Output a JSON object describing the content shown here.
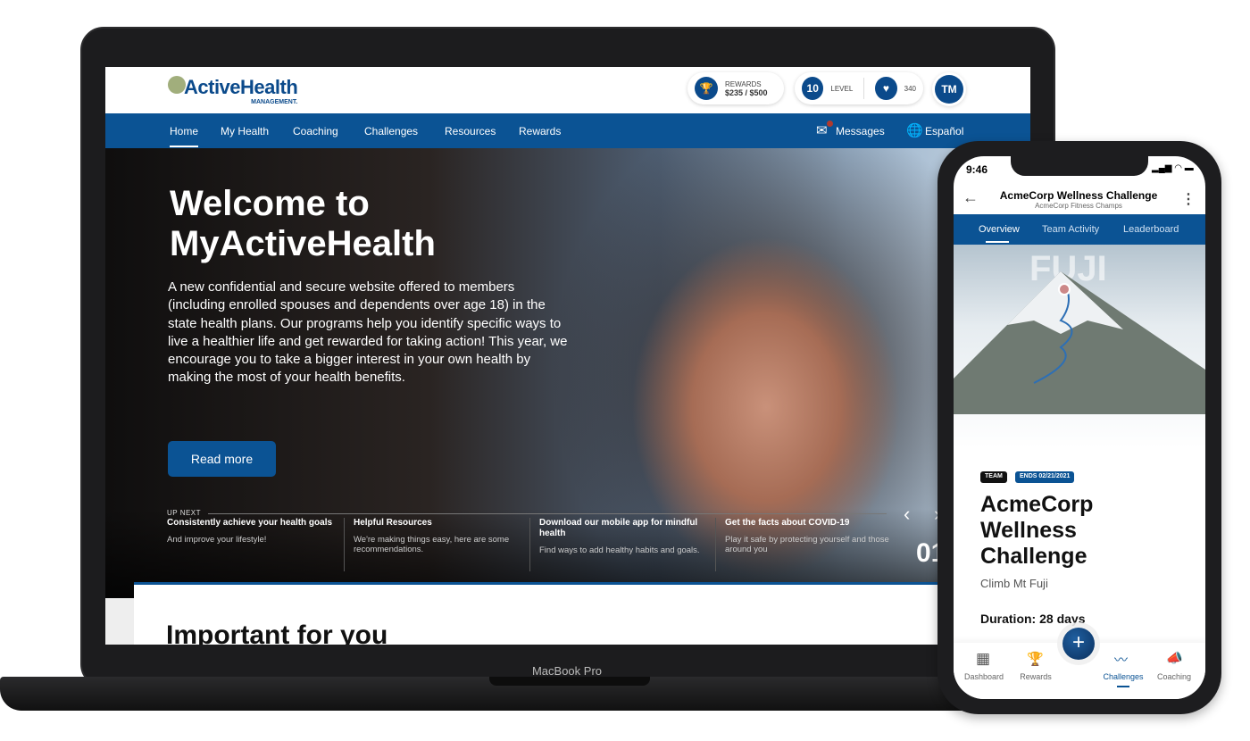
{
  "laptop": {
    "label": "MacBook Pro"
  },
  "site": {
    "logo": {
      "name": "ActiveHealth",
      "sub": "MANAGEMENT."
    },
    "rewards": {
      "label": "REWARDS",
      "value": "$235 / $500",
      "icon": "trophy-icon"
    },
    "level": {
      "value": "10",
      "label": "LEVEL"
    },
    "hearts": {
      "value": "340",
      "icon": "heart-icon"
    },
    "avatar": "TM",
    "nav": [
      "Home",
      "My Health",
      "Coaching",
      "Challenges",
      "Resources",
      "Rewards"
    ],
    "messages": "Messages",
    "language": "Español",
    "hero": {
      "title_line1": "Welcome to",
      "title_line2": "MyActiveHealth",
      "text": "A new confidential and secure website offered to members (including enrolled spouses and dependents over age 18) in the state health plans. Our programs help you identify specific ways to live a healthier life and get rewarded for taking action! This year, we encourage you to take a bigger interest in your own health by making the most of your health benefits.",
      "button": "Read more"
    },
    "up_next": {
      "label": "UP NEXT",
      "counter": "01",
      "cards": [
        {
          "title": "Consistently achieve your health goals",
          "desc": "And improve your lifestyle!"
        },
        {
          "title": "Helpful Resources",
          "desc": "We're making things easy, here are some recommendations."
        },
        {
          "title": "Download our mobile app for mindful health",
          "desc": "Find ways to add healthy habits and goals."
        },
        {
          "title": "Get the facts about COVID-19",
          "desc": "Play it safe by protecting yourself and those around you"
        }
      ]
    },
    "section_title": "Important for you",
    "accent": "#0b5394"
  },
  "app": {
    "time": "9:46",
    "title": "AcmeCorp Wellness Challenge",
    "subtitle": "AcmeCorp Fitness Champs",
    "tabs": [
      "Overview",
      "Team Activity",
      "Leaderboard"
    ],
    "image_label": "FUJI",
    "badges": [
      "TEAM",
      "ENDS 02/21/2021"
    ],
    "heading": "AcmeCorp Wellness Challenge",
    "desc": "Climb Mt Fuji",
    "duration": "Duration: 28 days",
    "bottom_nav": [
      "Dashboard",
      "Rewards",
      "Challenges",
      "Coaching"
    ]
  }
}
